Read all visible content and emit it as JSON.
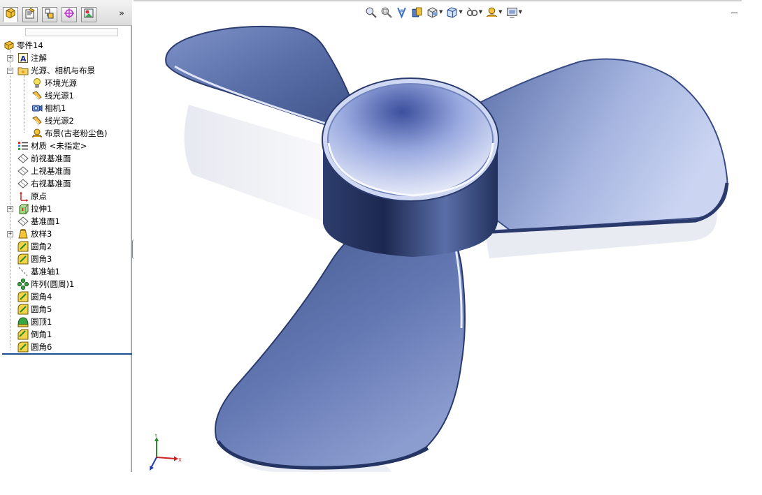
{
  "tree": {
    "root": "零件14",
    "items": [
      {
        "label": "注解",
        "icon": "annotations-icon"
      },
      {
        "label": "光源、相机与布景",
        "icon": "lights-cameras-folder-icon"
      },
      {
        "label": "环境光源",
        "icon": "ambient-light-icon"
      },
      {
        "label": "线光源1",
        "icon": "directional-light-icon"
      },
      {
        "label": "相机1",
        "icon": "camera-icon"
      },
      {
        "label": "线光源2",
        "icon": "directional-light-icon"
      },
      {
        "label": "布景(古老粉尘色)",
        "icon": "scene-icon"
      },
      {
        "label": "材质 <未指定>",
        "icon": "material-icon"
      },
      {
        "label": "前视基准面",
        "icon": "plane-icon"
      },
      {
        "label": "上视基准面",
        "icon": "plane-icon"
      },
      {
        "label": "右视基准面",
        "icon": "plane-icon"
      },
      {
        "label": "原点",
        "icon": "origin-icon"
      },
      {
        "label": "拉伸1",
        "icon": "extrude-icon"
      },
      {
        "label": "基准面1",
        "icon": "plane-icon"
      },
      {
        "label": "放样3",
        "icon": "loft-icon"
      },
      {
        "label": "圆角2",
        "icon": "fillet-icon"
      },
      {
        "label": "圆角3",
        "icon": "fillet-icon"
      },
      {
        "label": "基准轴1",
        "icon": "axis-icon"
      },
      {
        "label": "阵列(圆周)1",
        "icon": "circular-pattern-icon"
      },
      {
        "label": "圆角4",
        "icon": "fillet-icon"
      },
      {
        "label": "圆角5",
        "icon": "fillet-icon"
      },
      {
        "label": "圆顶1",
        "icon": "dome-icon"
      },
      {
        "label": "倒角1",
        "icon": "chamfer-icon"
      },
      {
        "label": "圆角6",
        "icon": "fillet-icon"
      }
    ]
  },
  "panel_tabs": [
    "feature-manager-tab-icon",
    "property-manager-tab-icon",
    "configuration-manager-tab-icon",
    "dim-xpert-tab-icon",
    "display-manager-tab-icon"
  ],
  "panel_more": "»",
  "triad": {
    "x_label": "X",
    "y_label": "Y"
  },
  "colors": {
    "accent": "#1c4d8f",
    "model": "#5a6fa8"
  }
}
